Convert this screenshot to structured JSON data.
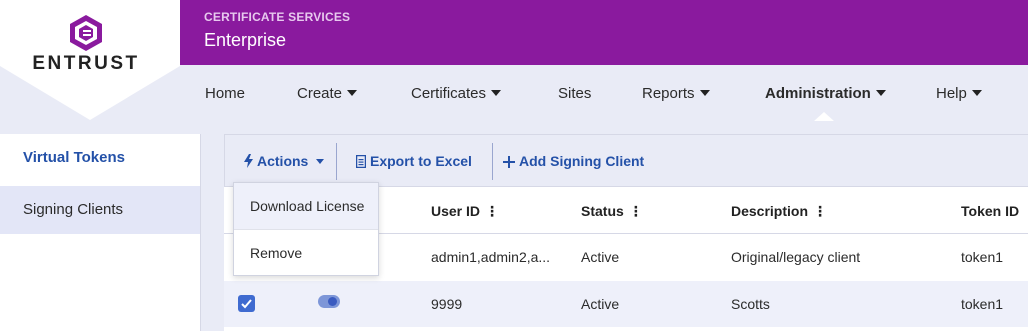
{
  "brand": {
    "logo_text": "ENTRUST",
    "service_label": "CERTIFICATE SERVICES",
    "service_title": "Enterprise",
    "colors": {
      "purple": "#8a1a9e",
      "accent_blue": "#2451a8"
    }
  },
  "nav": {
    "items": [
      {
        "label": "Home",
        "dropdown": false
      },
      {
        "label": "Create",
        "dropdown": true
      },
      {
        "label": "Certificates",
        "dropdown": true
      },
      {
        "label": "Sites",
        "dropdown": false
      },
      {
        "label": "Reports",
        "dropdown": true
      },
      {
        "label": "Administration",
        "dropdown": true,
        "active": true
      },
      {
        "label": "Help",
        "dropdown": true
      }
    ]
  },
  "sidebar": {
    "items": [
      {
        "label": "Virtual Tokens"
      },
      {
        "label": "Signing Clients",
        "selected": true
      }
    ]
  },
  "toolbar": {
    "actions_label": "Actions",
    "export_label": "Export to Excel",
    "add_label": "Add Signing Client"
  },
  "actions_menu": {
    "items": [
      {
        "label": "Download License"
      },
      {
        "label": "Remove"
      }
    ]
  },
  "table": {
    "columns": [
      "User ID",
      "Status",
      "Description",
      "Token ID"
    ],
    "rows": [
      {
        "user_id": "admin1,admin2,a...",
        "status": "Active",
        "description": "Original/legacy client",
        "token_id": "token1",
        "checked": false
      },
      {
        "user_id": "9999",
        "status": "Active",
        "description": "Scotts",
        "token_id": "token1",
        "checked": true
      }
    ]
  }
}
